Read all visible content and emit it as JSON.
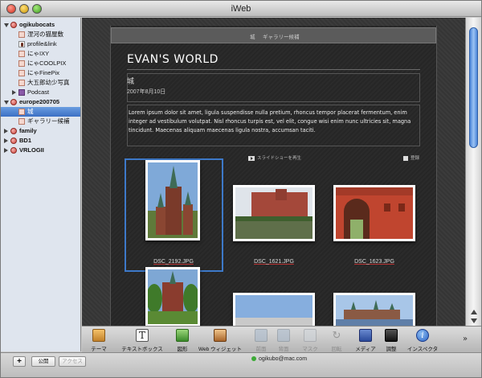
{
  "window": {
    "title": "iWeb"
  },
  "sidebar": {
    "items": [
      {
        "label": "ogikubocats",
        "type": "site",
        "expanded": true
      },
      {
        "label": "涅河の猫屋敷",
        "type": "page"
      },
      {
        "label": "profile&link",
        "type": "page-person"
      },
      {
        "label": "にゃIXY",
        "type": "page"
      },
      {
        "label": "にゃCOOLPIX",
        "type": "page"
      },
      {
        "label": "にゃFinePix",
        "type": "page"
      },
      {
        "label": "大五郎幼少写真",
        "type": "page"
      },
      {
        "label": "Podcast",
        "type": "page-podcast",
        "collapsed": true
      },
      {
        "label": "europe200705",
        "type": "site",
        "expanded": true
      },
      {
        "label": "城",
        "type": "page",
        "selected": true
      },
      {
        "label": "ギャラリー候補",
        "type": "page"
      },
      {
        "label": "family",
        "type": "site",
        "collapsed": true
      },
      {
        "label": "BD1",
        "type": "site",
        "collapsed": true
      },
      {
        "label": "VRLOGII",
        "type": "site",
        "collapsed": true
      }
    ]
  },
  "page": {
    "nav": {
      "item1": "城",
      "item2": "ギャラリー候補"
    },
    "site_title": "EVAN'S WORLD",
    "heading": "城",
    "date": "2007年8月10日",
    "body": "Lorem ipsum dolor sit amet, ligula suspendisse nulla pretium, rhoncus tempor placerat fermentum, enim integer ad vestibulum volutpat. Nisl rhoncus turpis est, vel elit, congue wisi enim nunc ultricies sit, magna tincidunt. Maecenas aliquam maecenas ligula nostra, accumsan taciti.",
    "slideshow_label": "スライドショーを再生",
    "subscribe_label": "登録",
    "photos": [
      {
        "caption": "DSC_2192.JPG",
        "selected": true
      },
      {
        "caption": "DSC_1621.JPG"
      },
      {
        "caption": "DSC_1623.JPG"
      },
      {
        "caption": ""
      },
      {
        "caption": ""
      },
      {
        "caption": ""
      }
    ]
  },
  "toolbar": {
    "theme": "テーマ",
    "textbox": "テキストボックス",
    "shapes": "図形",
    "web_widget": "Web ウィジェット",
    "front": "前面",
    "back": "背面",
    "mask": "マスク",
    "rotate": "回転",
    "media": "メディア",
    "adjust": "調整",
    "inspector": "インスペクタ",
    "more": "»"
  },
  "statusbar": {
    "add": "+",
    "publish": "公開",
    "visit": "アクセス",
    "account": "ogikubo@mac.com"
  },
  "colors": {
    "selection": "#3d79c9",
    "page_bg": "#2b2b2b",
    "sidebar_bg": "#dfe5ee"
  }
}
